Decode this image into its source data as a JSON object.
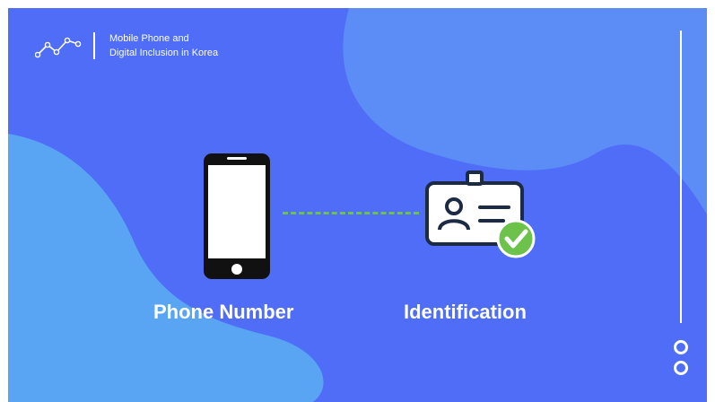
{
  "header": {
    "title_line1": "Mobile Phone and",
    "title_line2": "Digital Inclusion in Korea",
    "logo_icon": "trend-line-icon"
  },
  "diagram": {
    "left_label": "Phone Number",
    "right_label": "Identification",
    "left_icon": "smartphone-icon",
    "right_icon": "id-card-verified-icon",
    "connector_color": "#6cc24a"
  },
  "colors": {
    "background": "#4f6df6",
    "blob_upper": "#5c8cf6",
    "blob_lower": "#5aa8f2",
    "check": "#6cc24a",
    "text": "#ffffff"
  },
  "navigation": {
    "dots": [
      "slide-dot-1",
      "slide-dot-2"
    ]
  }
}
